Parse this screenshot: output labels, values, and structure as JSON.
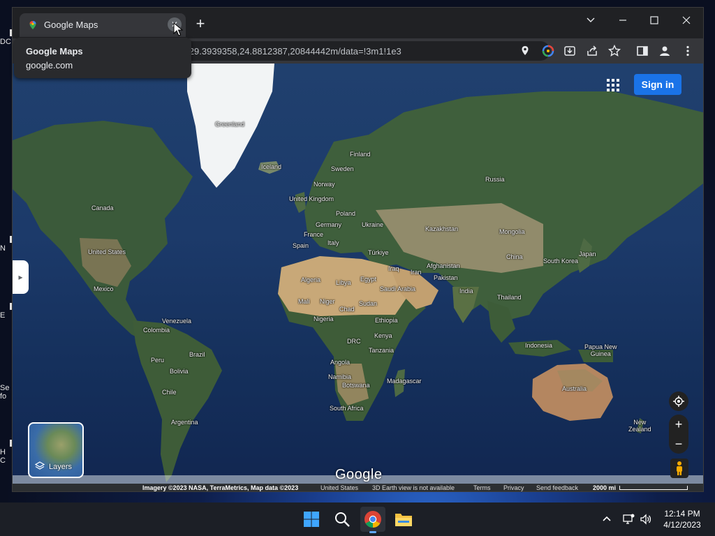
{
  "desktop": {
    "icon_labels": [
      "DC",
      "N",
      "E",
      "Se",
      "fo",
      "H",
      "C"
    ]
  },
  "browser": {
    "tab": {
      "title": "Google Maps",
      "close_glyph": "✕"
    },
    "new_tab_glyph": "+",
    "url": "/@29.3939358,24.8812387,20844442m/data=!3m1!1e3",
    "tooltip": {
      "title": "Google Maps",
      "domain": "google.com"
    }
  },
  "map": {
    "sign_in_label": "Sign in",
    "layers_label": "Layers",
    "logo": "Google",
    "zoom_in": "+",
    "zoom_out": "−",
    "side_toggle": "▸",
    "footer": {
      "imagery": "Imagery ©2023 NASA, TerraMetrics, Map data ©2023",
      "region": "United States",
      "notice": "3D Earth view is not available",
      "terms": "Terms",
      "privacy": "Privacy",
      "feedback": "Send feedback",
      "scale": "2000 mi"
    },
    "places": {
      "greenland": "Greenland",
      "iceland": "Iceland",
      "finland": "Finland",
      "sweden": "Sweden",
      "norway": "Norway",
      "russia": "Russia",
      "uk": "United Kingdom",
      "poland": "Poland",
      "germany": "Germany",
      "ukraine": "Ukraine",
      "france": "France",
      "italy": "Italy",
      "spain": "Spain",
      "turkiye": "Türkiye",
      "kazakhstan": "Kazakhstan",
      "mongolia": "Mongolia",
      "canada": "Canada",
      "united_states": "United States",
      "mexico": "Mexico",
      "china": "China",
      "japan": "Japan",
      "south_korea": "South Korea",
      "iraq": "Iraq",
      "iran": "Iran",
      "afghanistan": "Afghanistan",
      "pakistan": "Pakistan",
      "india": "India",
      "algeria": "Algeria",
      "libya": "Libya",
      "egypt": "Egypt",
      "saudi_arabia": "Saudi Arabia",
      "mali": "Mali",
      "niger": "Niger",
      "chad": "Chad",
      "sudan": "Sudan",
      "thailand": "Thailand",
      "nigeria": "Nigeria",
      "ethiopia": "Ethiopia",
      "venezuela": "Venezuela",
      "colombia": "Colombia",
      "drc": "DRC",
      "kenya": "Kenya",
      "indonesia": "Indonesia",
      "papua": "Papua New\nGuinea",
      "tanzania": "Tanzania",
      "peru": "Peru",
      "brazil": "Brazil",
      "angola": "Angola",
      "namibia": "Namibia",
      "botswana": "Botswana",
      "madagascar": "Madagascar",
      "bolivia": "Bolivia",
      "chile": "Chile",
      "australia": "Australia",
      "south_africa": "South Africa",
      "argentina": "Argentina",
      "new_zealand": "New\nZealand"
    }
  },
  "taskbar": {
    "time": "12:14 PM",
    "date": "4/12/2023"
  },
  "colors": {
    "accent": "#1a73e8",
    "ocean": "#1c3a6a",
    "land_green": "#3b5a3a",
    "desert": "#c8a878"
  }
}
